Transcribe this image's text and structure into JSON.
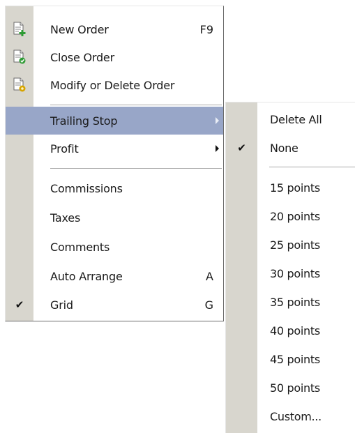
{
  "main_menu": {
    "items": [
      {
        "label": "New Order",
        "shortcut": "F9",
        "icon": "new-order-icon"
      },
      {
        "label": "Close Order",
        "shortcut": "",
        "icon": "close-order-icon"
      },
      {
        "label": "Modify or Delete Order",
        "shortcut": "",
        "icon": "modify-order-icon"
      },
      {
        "label": "Trailing Stop",
        "shortcut": "",
        "submenu": true,
        "highlighted": true
      },
      {
        "label": "Profit",
        "shortcut": "",
        "submenu": true
      },
      {
        "label": "Commissions",
        "shortcut": ""
      },
      {
        "label": "Taxes",
        "shortcut": ""
      },
      {
        "label": "Comments",
        "shortcut": ""
      },
      {
        "label": "Auto Arrange",
        "shortcut": "A"
      },
      {
        "label": "Grid",
        "shortcut": "G",
        "checked": true
      }
    ]
  },
  "submenu": {
    "items": [
      {
        "label": "Delete All"
      },
      {
        "label": "None",
        "checked": true
      },
      {
        "label": "15 points"
      },
      {
        "label": "20 points"
      },
      {
        "label": "25 points"
      },
      {
        "label": "30 points"
      },
      {
        "label": "35 points"
      },
      {
        "label": "40 points"
      },
      {
        "label": "45 points"
      },
      {
        "label": "50 points"
      },
      {
        "label": "Custom..."
      }
    ]
  },
  "glyphs": {
    "check": "✔"
  },
  "colors": {
    "gutter": "#d8d6ce",
    "highlight": "#98a6c8",
    "text": "#1a1a1a",
    "icon_green": "#2e9b34",
    "icon_yellow": "#d6a400"
  }
}
